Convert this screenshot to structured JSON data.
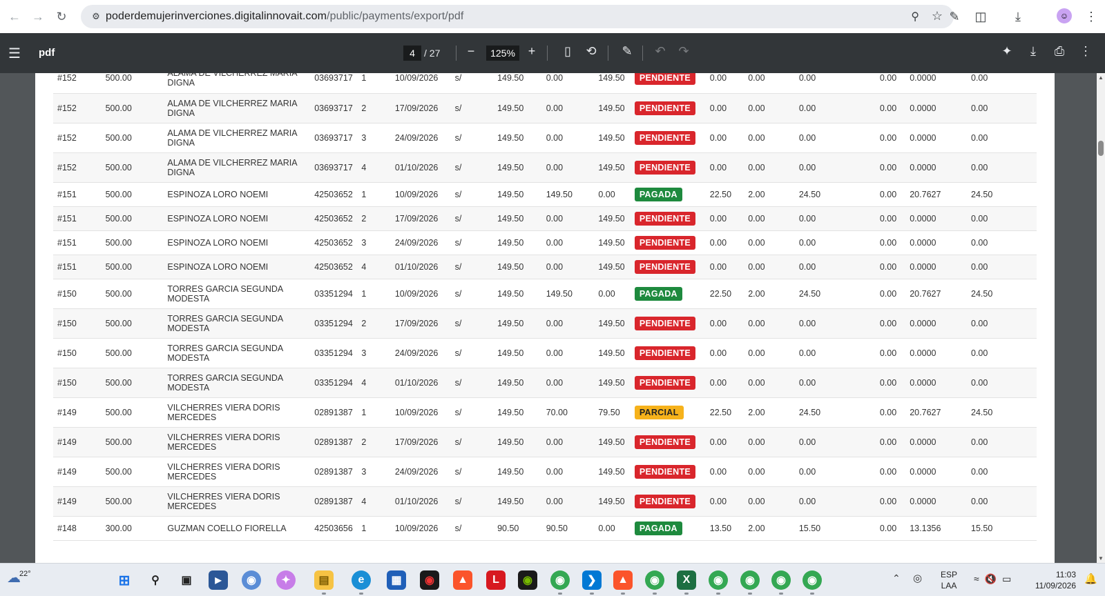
{
  "browser": {
    "url_host": "poderdemujerinverciones.digitalinnovait.com",
    "url_path": "/public/payments/export/pdf"
  },
  "pdf_toolbar": {
    "title": "pdf",
    "current_page": "4",
    "total_pages": "/ 27",
    "zoom": "125%"
  },
  "table": {
    "rows": [
      {
        "id": "#152",
        "amount": "500.00",
        "name1": "ALAMA DE VILCHERREZ MARIA",
        "name2": "DIGNA",
        "dni": "03693717",
        "n": "1",
        "date": "10/09/2026",
        "cur": "s/",
        "v1": "149.50",
        "v2": "0.00",
        "v3": "149.50",
        "status": "PENDIENTE",
        "v4": "0.00",
        "v5": "0.00",
        "v6": "0.00",
        "v7": "0.00",
        "v8": "0.0000",
        "v9": "0.00"
      },
      {
        "id": "#152",
        "amount": "500.00",
        "name1": "ALAMA DE VILCHERREZ MARIA",
        "name2": "DIGNA",
        "dni": "03693717",
        "n": "2",
        "date": "17/09/2026",
        "cur": "s/",
        "v1": "149.50",
        "v2": "0.00",
        "v3": "149.50",
        "status": "PENDIENTE",
        "v4": "0.00",
        "v5": "0.00",
        "v6": "0.00",
        "v7": "0.00",
        "v8": "0.0000",
        "v9": "0.00"
      },
      {
        "id": "#152",
        "amount": "500.00",
        "name1": "ALAMA DE VILCHERREZ MARIA",
        "name2": "DIGNA",
        "dni": "03693717",
        "n": "3",
        "date": "24/09/2026",
        "cur": "s/",
        "v1": "149.50",
        "v2": "0.00",
        "v3": "149.50",
        "status": "PENDIENTE",
        "v4": "0.00",
        "v5": "0.00",
        "v6": "0.00",
        "v7": "0.00",
        "v8": "0.0000",
        "v9": "0.00"
      },
      {
        "id": "#152",
        "amount": "500.00",
        "name1": "ALAMA DE VILCHERREZ MARIA",
        "name2": "DIGNA",
        "dni": "03693717",
        "n": "4",
        "date": "01/10/2026",
        "cur": "s/",
        "v1": "149.50",
        "v2": "0.00",
        "v3": "149.50",
        "status": "PENDIENTE",
        "v4": "0.00",
        "v5": "0.00",
        "v6": "0.00",
        "v7": "0.00",
        "v8": "0.0000",
        "v9": "0.00"
      },
      {
        "id": "#151",
        "amount": "500.00",
        "name1": "ESPINOZA LORO NOEMI",
        "name2": "",
        "dni": "42503652",
        "n": "1",
        "date": "10/09/2026",
        "cur": "s/",
        "v1": "149.50",
        "v2": "149.50",
        "v3": "0.00",
        "status": "PAGADA",
        "v4": "22.50",
        "v5": "2.00",
        "v6": "24.50",
        "v7": "0.00",
        "v8": "20.7627",
        "v9": "24.50"
      },
      {
        "id": "#151",
        "amount": "500.00",
        "name1": "ESPINOZA LORO NOEMI",
        "name2": "",
        "dni": "42503652",
        "n": "2",
        "date": "17/09/2026",
        "cur": "s/",
        "v1": "149.50",
        "v2": "0.00",
        "v3": "149.50",
        "status": "PENDIENTE",
        "v4": "0.00",
        "v5": "0.00",
        "v6": "0.00",
        "v7": "0.00",
        "v8": "0.0000",
        "v9": "0.00"
      },
      {
        "id": "#151",
        "amount": "500.00",
        "name1": "ESPINOZA LORO NOEMI",
        "name2": "",
        "dni": "42503652",
        "n": "3",
        "date": "24/09/2026",
        "cur": "s/",
        "v1": "149.50",
        "v2": "0.00",
        "v3": "149.50",
        "status": "PENDIENTE",
        "v4": "0.00",
        "v5": "0.00",
        "v6": "0.00",
        "v7": "0.00",
        "v8": "0.0000",
        "v9": "0.00"
      },
      {
        "id": "#151",
        "amount": "500.00",
        "name1": "ESPINOZA LORO NOEMI",
        "name2": "",
        "dni": "42503652",
        "n": "4",
        "date": "01/10/2026",
        "cur": "s/",
        "v1": "149.50",
        "v2": "0.00",
        "v3": "149.50",
        "status": "PENDIENTE",
        "v4": "0.00",
        "v5": "0.00",
        "v6": "0.00",
        "v7": "0.00",
        "v8": "0.0000",
        "v9": "0.00"
      },
      {
        "id": "#150",
        "amount": "500.00",
        "name1": "TORRES GARCIA SEGUNDA",
        "name2": "MODESTA",
        "dni": "03351294",
        "n": "1",
        "date": "10/09/2026",
        "cur": "s/",
        "v1": "149.50",
        "v2": "149.50",
        "v3": "0.00",
        "status": "PAGADA",
        "v4": "22.50",
        "v5": "2.00",
        "v6": "24.50",
        "v7": "0.00",
        "v8": "20.7627",
        "v9": "24.50"
      },
      {
        "id": "#150",
        "amount": "500.00",
        "name1": "TORRES GARCIA SEGUNDA",
        "name2": "MODESTA",
        "dni": "03351294",
        "n": "2",
        "date": "17/09/2026",
        "cur": "s/",
        "v1": "149.50",
        "v2": "0.00",
        "v3": "149.50",
        "status": "PENDIENTE",
        "v4": "0.00",
        "v5": "0.00",
        "v6": "0.00",
        "v7": "0.00",
        "v8": "0.0000",
        "v9": "0.00"
      },
      {
        "id": "#150",
        "amount": "500.00",
        "name1": "TORRES GARCIA SEGUNDA",
        "name2": "MODESTA",
        "dni": "03351294",
        "n": "3",
        "date": "24/09/2026",
        "cur": "s/",
        "v1": "149.50",
        "v2": "0.00",
        "v3": "149.50",
        "status": "PENDIENTE",
        "v4": "0.00",
        "v5": "0.00",
        "v6": "0.00",
        "v7": "0.00",
        "v8": "0.0000",
        "v9": "0.00"
      },
      {
        "id": "#150",
        "amount": "500.00",
        "name1": "TORRES GARCIA SEGUNDA",
        "name2": "MODESTA",
        "dni": "03351294",
        "n": "4",
        "date": "01/10/2026",
        "cur": "s/",
        "v1": "149.50",
        "v2": "0.00",
        "v3": "149.50",
        "status": "PENDIENTE",
        "v4": "0.00",
        "v5": "0.00",
        "v6": "0.00",
        "v7": "0.00",
        "v8": "0.0000",
        "v9": "0.00"
      },
      {
        "id": "#149",
        "amount": "500.00",
        "name1": "VILCHERRES VIERA DORIS",
        "name2": "MERCEDES",
        "dni": "02891387",
        "n": "1",
        "date": "10/09/2026",
        "cur": "s/",
        "v1": "149.50",
        "v2": "70.00",
        "v3": "79.50",
        "status": "PARCIAL",
        "v4": "22.50",
        "v5": "2.00",
        "v6": "24.50",
        "v7": "0.00",
        "v8": "20.7627",
        "v9": "24.50"
      },
      {
        "id": "#149",
        "amount": "500.00",
        "name1": "VILCHERRES VIERA DORIS",
        "name2": "MERCEDES",
        "dni": "02891387",
        "n": "2",
        "date": "17/09/2026",
        "cur": "s/",
        "v1": "149.50",
        "v2": "0.00",
        "v3": "149.50",
        "status": "PENDIENTE",
        "v4": "0.00",
        "v5": "0.00",
        "v6": "0.00",
        "v7": "0.00",
        "v8": "0.0000",
        "v9": "0.00"
      },
      {
        "id": "#149",
        "amount": "500.00",
        "name1": "VILCHERRES VIERA DORIS",
        "name2": "MERCEDES",
        "dni": "02891387",
        "n": "3",
        "date": "24/09/2026",
        "cur": "s/",
        "v1": "149.50",
        "v2": "0.00",
        "v3": "149.50",
        "status": "PENDIENTE",
        "v4": "0.00",
        "v5": "0.00",
        "v6": "0.00",
        "v7": "0.00",
        "v8": "0.0000",
        "v9": "0.00"
      },
      {
        "id": "#149",
        "amount": "500.00",
        "name1": "VILCHERRES VIERA DORIS",
        "name2": "MERCEDES",
        "dni": "02891387",
        "n": "4",
        "date": "01/10/2026",
        "cur": "s/",
        "v1": "149.50",
        "v2": "0.00",
        "v3": "149.50",
        "status": "PENDIENTE",
        "v4": "0.00",
        "v5": "0.00",
        "v6": "0.00",
        "v7": "0.00",
        "v8": "0.0000",
        "v9": "0.00"
      },
      {
        "id": "#148",
        "amount": "300.00",
        "name1": "GUZMAN COELLO FIORELLA",
        "name2": "",
        "dni": "42503656",
        "n": "1",
        "date": "10/09/2026",
        "cur": "s/",
        "v1": "90.50",
        "v2": "90.50",
        "v3": "0.00",
        "status": "PAGADA",
        "v4": "13.50",
        "v5": "2.00",
        "v6": "15.50",
        "v7": "0.00",
        "v8": "13.1356",
        "v9": "15.50"
      }
    ]
  },
  "status_colors": {
    "PENDIENTE": "#d9262c",
    "PAGADA": "#1e8a3e",
    "PARCIAL": "#f6b21b"
  },
  "taskbar": {
    "weather_temp": "22°",
    "lang_top": "ESP",
    "lang_bottom": "LAA",
    "time": "11:03",
    "date": "11/09/2026"
  }
}
